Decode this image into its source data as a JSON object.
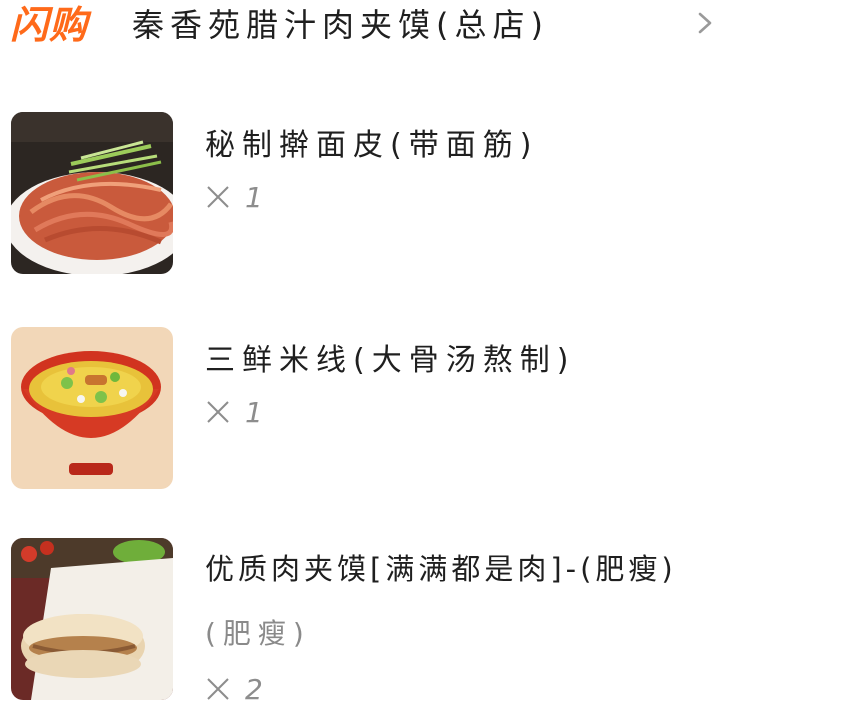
{
  "header": {
    "brand": "闪购",
    "store_name": "秦香苑腊汁肉夹馍(总店)",
    "chevron_icon": "chevron-right-icon"
  },
  "items": [
    {
      "title": "秘制擀面皮(带面筋)",
      "quantity": "1",
      "image": "noodle-dish-photo"
    },
    {
      "title": "三鲜米线(大骨汤熬制)",
      "quantity": "1",
      "image": "rice-noodle-soup-photo"
    },
    {
      "title": "优质肉夹馍[满满都是肉]-(肥瘦)",
      "subtitle": "(肥瘦)",
      "quantity": "2",
      "image": "roujiamo-photo"
    }
  ],
  "colors": {
    "brand": "#ff6a1a",
    "text": "#1f1f1f",
    "muted": "#8d8d8d"
  }
}
